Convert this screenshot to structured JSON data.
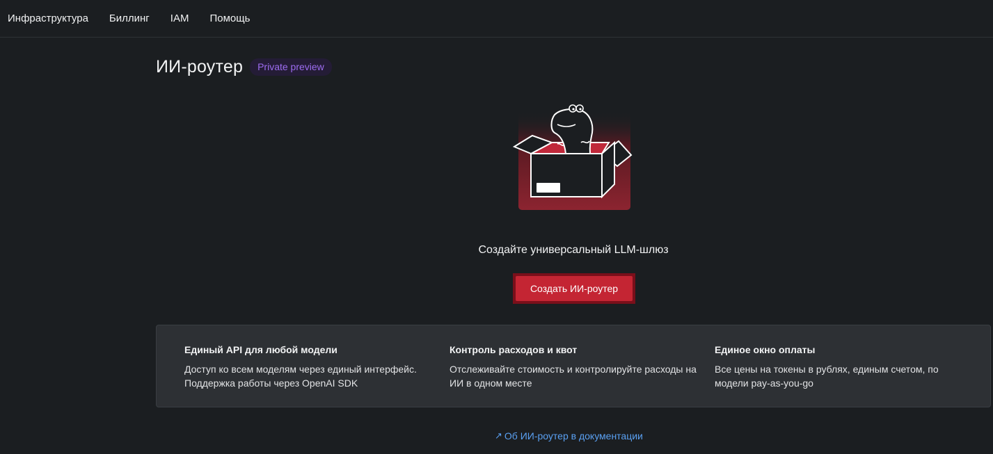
{
  "nav": {
    "items": [
      {
        "label": "Инфраструктура"
      },
      {
        "label": "Биллинг"
      },
      {
        "label": "IAM"
      },
      {
        "label": "Помощь"
      }
    ]
  },
  "header": {
    "title": "ИИ-роутер",
    "badge": "Private preview"
  },
  "empty_state": {
    "illustration_icon": "dino-in-box-illustration",
    "title": "Создайте универсальный LLM-шлюз",
    "create_label": "Создать ИИ-роутер"
  },
  "features": [
    {
      "title": "Единый API для любой модели",
      "text": "Доступ ко всем моделям через единый интерфейс. Поддержка работы через OpenAI SDK"
    },
    {
      "title": "Контроль расходов и квот",
      "text": "Отслеживайте стоимость и контролируйте расходы на ИИ в одном месте"
    },
    {
      "title": "Единое окно оплаты",
      "text": "Все цены на токены в рублях, единым счетом, по модели pay-as-you-go"
    }
  ],
  "docs_link": {
    "icon": "external-link-arrow-icon",
    "label": "Об ИИ-роутер в документации"
  },
  "colors": {
    "background": "#1b1e21",
    "accent": "#c42533",
    "badge_text": "#9d6cf0",
    "link": "#5aa0f2"
  }
}
